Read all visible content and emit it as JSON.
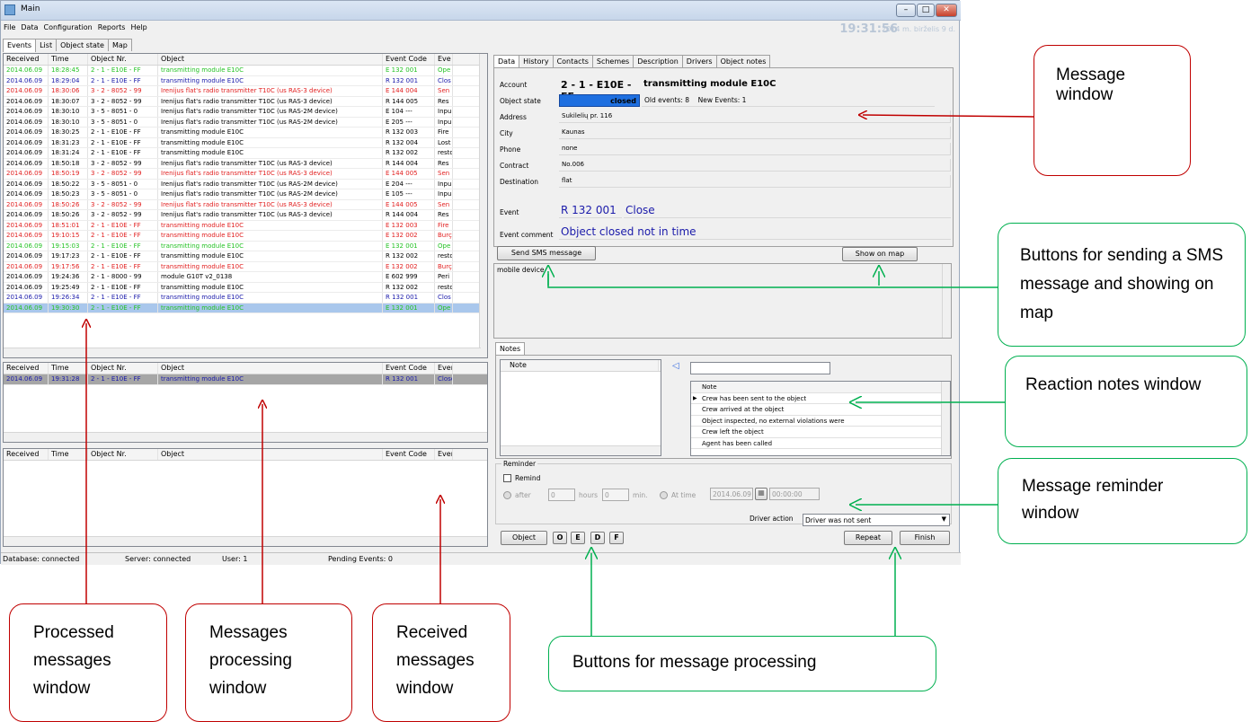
{
  "window": {
    "title": "Main",
    "clock": "19:31:56",
    "date": "2014 m. birželis 9 d.",
    "ctrl": [
      "–",
      "□",
      "✕"
    ]
  },
  "menu": [
    "File",
    "Data",
    "Configuration",
    "Reports",
    "Help"
  ],
  "left_tabs": [
    "Events",
    "List",
    "Object state",
    "Map"
  ],
  "columns": {
    "processed": [
      "Received",
      "Time",
      "Object Nr.",
      "Object",
      "Event Code",
      "Eve"
    ],
    "processing": [
      "Received",
      "Time",
      "Object Nr.",
      "Object",
      "Event Code",
      "Event"
    ],
    "received": [
      "Received",
      "Time",
      "Object Nr.",
      "Object",
      "Event Code",
      "Ever"
    ]
  },
  "processed_rows": [
    {
      "c": "green",
      "v": [
        "2014.06.09",
        "18:28:45",
        "2 - 1 - E10E - FF",
        "transmitting module E10C",
        "E 132 001",
        "Ope"
      ]
    },
    {
      "c": "blue",
      "v": [
        "2014.06.09",
        "18:29:04",
        "2 - 1 - E10E - FF",
        "transmitting module E10C",
        "R 132 001",
        "Clos"
      ]
    },
    {
      "c": "red",
      "v": [
        "2014.06.09",
        "18:30:06",
        "3 - 2 - 8052 - 99",
        "Irenijus flat's radio transmitter T10C (us RAS-3 device)",
        "E 144 004",
        "Sen"
      ]
    },
    {
      "c": "black",
      "v": [
        "2014.06.09",
        "18:30:07",
        "3 - 2 - 8052 - 99",
        "Irenijus flat's radio transmitter T10C (us RAS-3 device)",
        "R 144 005",
        "Res"
      ]
    },
    {
      "c": "black",
      "v": [
        "2014.06.09",
        "18:30:10",
        "3 - 5 - 8051 - 0",
        "Irenijus flat's radio transmitter T10C (us RAS-2M device)",
        "E 104 ---",
        "Inpu"
      ]
    },
    {
      "c": "black",
      "v": [
        "2014.06.09",
        "18:30:10",
        "3 - 5 - 8051 - 0",
        "Irenijus flat's radio transmitter T10C (us RAS-2M device)",
        "E 205 ---",
        "Inpu"
      ]
    },
    {
      "c": "black",
      "v": [
        "2014.06.09",
        "18:30:25",
        "2 - 1 - E10E - FF",
        "transmitting module E10C",
        "R 132 003",
        "Fire"
      ]
    },
    {
      "c": "black",
      "v": [
        "2014.06.09",
        "18:31:23",
        "2 - 1 - E10E - FF",
        "transmitting module E10C",
        "R 132 004",
        "Lost"
      ]
    },
    {
      "c": "black",
      "v": [
        "2014.06.09",
        "18:31:24",
        "2 - 1 - E10E - FF",
        "transmitting module E10C",
        "R 132 002",
        "resto"
      ]
    },
    {
      "c": "black",
      "v": [
        "2014.06.09",
        "18:50:18",
        "3 - 2 - 8052 - 99",
        "Irenijus flat's radio transmitter T10C (us RAS-3 device)",
        "R 144 004",
        "Res"
      ]
    },
    {
      "c": "red",
      "v": [
        "2014.06.09",
        "18:50:19",
        "3 - 2 - 8052 - 99",
        "Irenijus flat's radio transmitter T10C (us RAS-3 device)",
        "E 144 005",
        "Sen"
      ]
    },
    {
      "c": "black",
      "v": [
        "2014.06.09",
        "18:50:22",
        "3 - 5 - 8051 - 0",
        "Irenijus flat's radio transmitter T10C (us RAS-2M device)",
        "E 204 ---",
        "Inpu"
      ]
    },
    {
      "c": "black",
      "v": [
        "2014.06.09",
        "18:50:23",
        "3 - 5 - 8051 - 0",
        "Irenijus flat's radio transmitter T10C (us RAS-2M device)",
        "E 105 ---",
        "Inpu"
      ]
    },
    {
      "c": "red",
      "v": [
        "2014.06.09",
        "18:50:26",
        "3 - 2 - 8052 - 99",
        "Irenijus flat's radio transmitter T10C (us RAS-3 device)",
        "E 144 005",
        "Sen"
      ]
    },
    {
      "c": "black",
      "v": [
        "2014.06.09",
        "18:50:26",
        "3 - 2 - 8052 - 99",
        "Irenijus flat's radio transmitter T10C (us RAS-3 device)",
        "R 144 004",
        "Res"
      ]
    },
    {
      "c": "red",
      "v": [
        "2014.06.09",
        "18:51:01",
        "2 - 1 - E10E - FF",
        "transmitting module E10C",
        "E 132 003",
        "Fire"
      ]
    },
    {
      "c": "red",
      "v": [
        "2014.06.09",
        "19:10:15",
        "2 - 1 - E10E - FF",
        "transmitting module E10C",
        "E 132 002",
        "Burç"
      ]
    },
    {
      "c": "green",
      "v": [
        "2014.06.09",
        "19:15:03",
        "2 - 1 - E10E - FF",
        "transmitting module E10C",
        "E 132 001",
        "Ope"
      ]
    },
    {
      "c": "black",
      "v": [
        "2014.06.09",
        "19:17:23",
        "2 - 1 - E10E - FF",
        "transmitting module E10C",
        "R 132 002",
        "resto"
      ]
    },
    {
      "c": "red",
      "v": [
        "2014.06.09",
        "19:17:56",
        "2 - 1 - E10E - FF",
        "transmitting module E10C",
        "E 132 002",
        "Burç"
      ]
    },
    {
      "c": "black",
      "v": [
        "2014.06.09",
        "19:24:36",
        "2 - 1 - 8000 - 99",
        "module G10T v2_0138",
        "E 602 999",
        "Peri"
      ]
    },
    {
      "c": "black",
      "v": [
        "2014.06.09",
        "19:25:49",
        "2 - 1 - E10E - FF",
        "transmitting module E10C",
        "R 132 002",
        "resto"
      ]
    },
    {
      "c": "blue",
      "v": [
        "2014.06.09",
        "19:26:34",
        "2 - 1 - E10E - FF",
        "transmitting module E10C",
        "R 132 001",
        "Clos"
      ]
    },
    {
      "c": "green",
      "v": [
        "2014.06.09",
        "19:30:30",
        "2 - 1 - E10E - FF",
        "transmitting module E10C",
        "E 132 001",
        "Ope"
      ]
    }
  ],
  "processing_rows": [
    {
      "c": "blue",
      "v": [
        "2014.06.09",
        "19:31:28",
        "2 - 1 - E10E - FF",
        "transmitting module E10C",
        "R 132 001",
        "Close"
      ]
    }
  ],
  "right_tabs": [
    "Data",
    "History",
    "Contacts",
    "Schemes",
    "Description",
    "Drivers",
    "Object notes"
  ],
  "details": {
    "account_label": "Account",
    "account": "2 - 1 - E10E - FF",
    "account_obj": "transmitting module E10C",
    "state_label": "Object state",
    "state": "closed",
    "old_events": "Old events: 8",
    "new_events": "New Events: 1",
    "address_label": "Address",
    "address": "Sukilelių pr. 116",
    "city_label": "City",
    "city": "Kaunas",
    "phone_label": "Phone",
    "phone": "none",
    "contract_label": "Contract",
    "contract": "No.006",
    "dest_label": "Destination",
    "dest": "flat",
    "event_label": "Event",
    "event_code": "R 132 001",
    "event_name": "Close",
    "comment_label": "Event comment",
    "comment": "Object closed not in time"
  },
  "sms_button": "Send SMS message",
  "map_button": "Show on map",
  "device_text": "mobile device",
  "notes": {
    "tab": "Notes",
    "col": "Note",
    "list_header": "Note",
    "items": [
      "Crew has been sent to the object",
      "Crew arrived at the object",
      "Object inspected, no external violations were",
      "Crew left the object",
      "Agent has been called"
    ]
  },
  "reminder": {
    "title": "Reminder",
    "remind": "Remind",
    "after": "after",
    "hours_val": "0",
    "hours": "hours",
    "min_val": "0",
    "min": "min.",
    "at_time": "At time",
    "date": "2014.06.09",
    "time": "00:00:00",
    "driver_label": "Driver action",
    "driver_value": "Driver was not sent"
  },
  "bottom_buttons": {
    "object": "Object",
    "o": "O",
    "e": "E",
    "d": "D",
    "f": "F",
    "repeat": "Repeat",
    "finish": "Finish"
  },
  "status": {
    "db": "Database: connected",
    "server": "Server: connected",
    "user": "User: 1",
    "pending": "Pending Events: 0"
  },
  "callouts": {
    "message_window": "Message window",
    "sms_map": "Buttons for sending a SMS message and showing on map",
    "reaction_notes": "Reaction notes window",
    "reminder": "Message reminder window",
    "processing_buttons": "Buttons for message processing",
    "processed": "Processed messages window",
    "processing": "Messages processing window",
    "received": "Received messages window"
  },
  "colors": {
    "callout_red": "#c00000",
    "callout_green": "#00b050",
    "row_green": "#24c224",
    "row_blue": "#1a1aaa",
    "row_red": "#e22020",
    "state_bar": "#1e6fe0"
  }
}
